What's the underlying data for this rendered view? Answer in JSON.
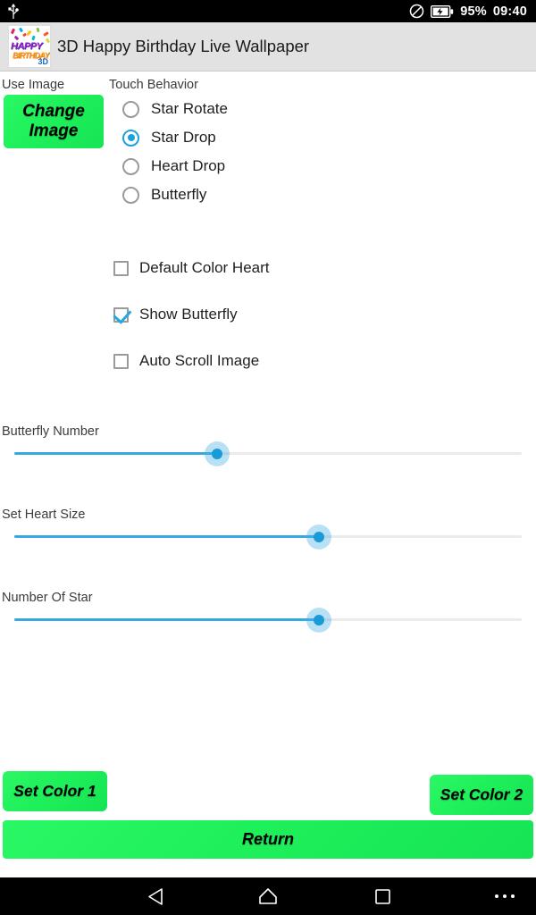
{
  "statusbar": {
    "usb_icon": "usb-icon",
    "dnd_icon": "do-not-disturb-icon",
    "battery_icon": "battery-charging-icon",
    "battery_text": "95%",
    "clock": "09:40"
  },
  "actionbar": {
    "icon": "app-icon",
    "icon_word1": "HAPPY",
    "icon_word2": "BIRTHDAY",
    "icon_word3": "3D",
    "title": "3D Happy Birthday Live Wallpaper"
  },
  "main": {
    "use_image_label": "Use Image",
    "change_image_button": "Change Image",
    "touch_behavior_label": "Touch Behavior",
    "radios": [
      {
        "label": "Star Rotate",
        "checked": false
      },
      {
        "label": "Star Drop",
        "checked": true
      },
      {
        "label": "Heart Drop",
        "checked": false
      },
      {
        "label": "Butterfly",
        "checked": false
      }
    ],
    "checkboxes": [
      {
        "label": "Default Color Heart",
        "checked": false
      },
      {
        "label": "Show Butterfly",
        "checked": true
      },
      {
        "label": "Auto Scroll Image",
        "checked": false
      }
    ],
    "sliders": [
      {
        "label": "Butterfly Number",
        "percent": 40
      },
      {
        "label": "Set Heart Size",
        "percent": 60
      },
      {
        "label": "Number Of Star",
        "percent": 60
      }
    ],
    "set_color_1_button": "Set Color 1",
    "set_color_2_button": "Set Color 2",
    "return_button": "Return"
  },
  "navbar": {
    "back_icon": "back-triangle-icon",
    "home_icon": "home-icon",
    "recents_icon": "recents-square-icon",
    "more_icon": "more-dots-icon"
  },
  "colors": {
    "accent_blue": "#1ba1e2",
    "slider_blue": "#37a8e0",
    "button_green": "#1ef05a",
    "actionbar_gray": "#e2e2e2",
    "text_dark": "#1f1f1f",
    "label_gray": "#3b3b3b"
  }
}
